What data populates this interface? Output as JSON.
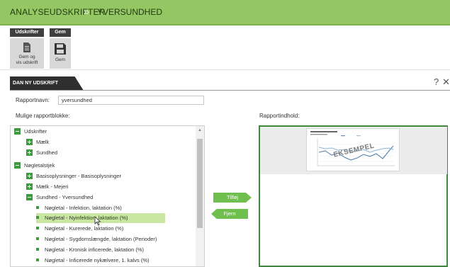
{
  "header": {
    "breadcrumb": [
      "ANALYSEUDSKRIFTER",
      "YVERSUNDHED"
    ],
    "separator": "»",
    "bg_color": "#94c664"
  },
  "toolbar": {
    "groups": [
      {
        "tab": "Udskrifter",
        "button_label": "Gem og vis udskrift",
        "button_label_line1": "Gem og",
        "button_label_line2": "vis udskrift",
        "icon": "document-icon"
      },
      {
        "tab": "Gem",
        "button_label": "Gem",
        "icon": "floppy-disk-icon"
      }
    ]
  },
  "section": {
    "tab_label": "DAN NY UDSKRIFT",
    "help_icon": "?",
    "close_icon": "✕"
  },
  "form": {
    "report_name_label": "Rapportnavn:",
    "report_name_value": "yversundhed",
    "available_blocks_label": "Mulige rapportblokke:",
    "report_content_label": "Rapportindhold:"
  },
  "tree": {
    "items": [
      {
        "label": "Udskrifter",
        "level": 0,
        "type": "collapse"
      },
      {
        "label": "Mælk",
        "level": 1,
        "type": "expand"
      },
      {
        "label": "Sundhed",
        "level": 1,
        "type": "expand"
      },
      {
        "label": "Nøgletalstjek",
        "level": 0,
        "type": "collapse"
      },
      {
        "label": "Basisoplysninger - Basisoplysninger",
        "level": 1,
        "type": "expand"
      },
      {
        "label": "Mælk - Mejeri",
        "level": 1,
        "type": "expand"
      },
      {
        "label": "Sundhed - Yversundhed",
        "level": 1,
        "type": "collapse"
      },
      {
        "label": "Nøgletal - Infektion, laktation (%)",
        "level": 2,
        "type": "leaf"
      },
      {
        "label": "Nøgletal - Nyinfektion, laktation (%)",
        "level": 2,
        "type": "leaf",
        "selected": true
      },
      {
        "label": "Nøgletal - Kurerede, laktation (%)",
        "level": 2,
        "type": "leaf"
      },
      {
        "label": "Nøgletal - Sygdomslængde, laktation (Perioder)",
        "level": 2,
        "type": "leaf"
      },
      {
        "label": "Nøgletal - Kronisk inficerede, laktation (%)",
        "level": 2,
        "type": "leaf"
      },
      {
        "label": "Nøgletal - Inficerede nykælvere, 1. kalvs (%)",
        "level": 2,
        "type": "leaf"
      }
    ]
  },
  "actions": {
    "add_label": "Tilføj",
    "remove_label": "Fjern",
    "color": "#6fbf4f"
  },
  "preview": {
    "watermark": "EKSEMPEL"
  }
}
